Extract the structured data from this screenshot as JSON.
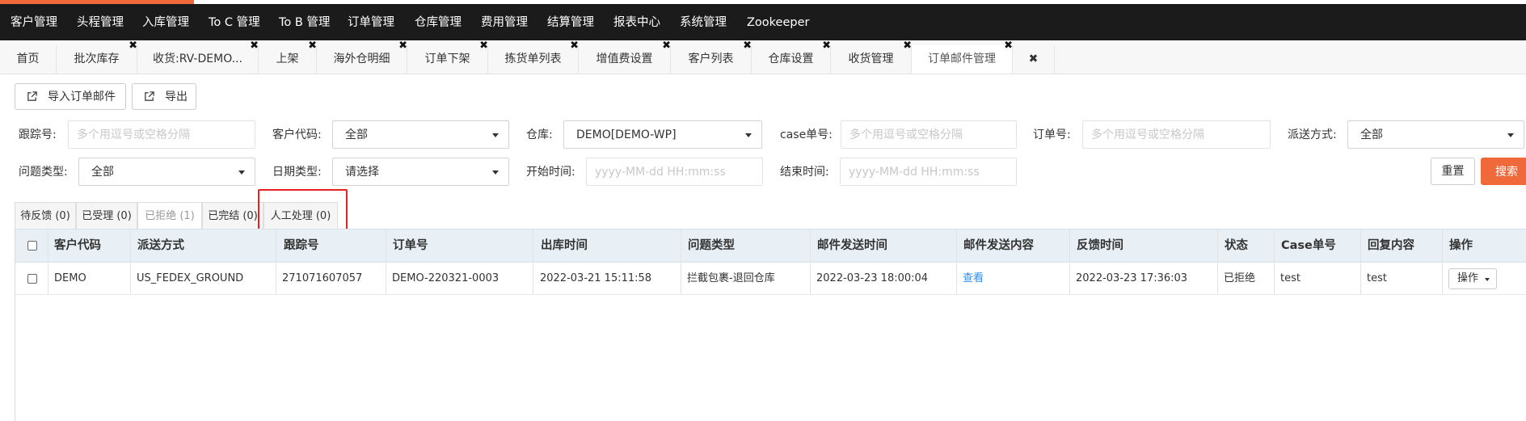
{
  "colors": {
    "brand_accent": "#f0693a",
    "nav_bg": "#1b1b1b",
    "header_bg": "#e8f0f5",
    "link": "#2d8cf0",
    "highlight_border": "#e8201e"
  },
  "topnav": {
    "items": [
      "客户管理",
      "头程管理",
      "入库管理",
      "To C 管理",
      "To B 管理",
      "订单管理",
      "仓库管理",
      "费用管理",
      "结算管理",
      "报表中心",
      "系统管理",
      "Zookeeper"
    ]
  },
  "tabs": {
    "items": [
      {
        "label": "首页"
      },
      {
        "label": "批次库存"
      },
      {
        "label": "收货:RV-DEMO..."
      },
      {
        "label": "上架"
      },
      {
        "label": "海外仓明细"
      },
      {
        "label": "订单下架"
      },
      {
        "label": "拣货单列表"
      },
      {
        "label": "增值费设置"
      },
      {
        "label": "客户列表"
      },
      {
        "label": "仓库设置"
      },
      {
        "label": "收货管理"
      },
      {
        "label": "订单邮件管理"
      },
      {
        "label": ""
      }
    ],
    "active_index": 11,
    "close_glyph": "✖"
  },
  "toolbar": {
    "import_label": "导入订单邮件",
    "export_label": "导出",
    "import_icon": "external-link-icon",
    "export_icon": "external-link-icon"
  },
  "filters": {
    "tracking": {
      "label": "跟踪号:",
      "placeholder": "多个用逗号或空格分隔",
      "value": ""
    },
    "customer_code": {
      "label": "客户代码:",
      "value": "全部"
    },
    "warehouse": {
      "label": "仓库:",
      "value": "DEMO[DEMO-WP]"
    },
    "case_no": {
      "label": "case单号:",
      "placeholder": "多个用逗号或空格分隔",
      "value": ""
    },
    "order_no": {
      "label": "订单号:",
      "placeholder": "多个用逗号或空格分隔",
      "value": ""
    },
    "ship_method": {
      "label": "派送方式:",
      "value": "全部"
    },
    "issue_type": {
      "label": "问题类型:",
      "value": "全部"
    },
    "date_type": {
      "label": "日期类型:",
      "value": "请选择"
    },
    "start_time": {
      "label": "开始时间:",
      "placeholder": "yyyy-MM-dd HH:mm:ss",
      "value": ""
    },
    "end_time": {
      "label": "结束时间:",
      "placeholder": "yyyy-MM-dd HH:mm:ss",
      "value": ""
    },
    "reset_label": "重置",
    "search_label": "搜索"
  },
  "status_tabs": {
    "items": [
      "待反馈 (0)",
      "已受理 (0)",
      "已拒绝 (1)",
      "已完结 (0)",
      "人工处理 (0)"
    ],
    "active_index": 2,
    "highlighted_index": 4
  },
  "table": {
    "columns": [
      "客户代码",
      "派送方式",
      "跟踪号",
      "订单号",
      "出库时间",
      "问题类型",
      "邮件发送时间",
      "邮件发送内容",
      "反馈时间",
      "状态",
      "Case单号",
      "回复内容",
      "操作"
    ],
    "rows": [
      {
        "customer_code": "DEMO",
        "ship_method": "US_FEDEX_GROUND",
        "tracking": "271071607057",
        "order_no": "DEMO-220321-0003",
        "out_time": "2022-03-21 15:11:58",
        "issue_type": "拦截包裹-退回仓库",
        "mail_time": "2022-03-23 18:00:04",
        "mail_content": "查看",
        "feedback_time": "2022-03-23 17:36:03",
        "status": "已拒绝",
        "case_no": "test",
        "reply": "test",
        "action": "操作"
      }
    ]
  }
}
